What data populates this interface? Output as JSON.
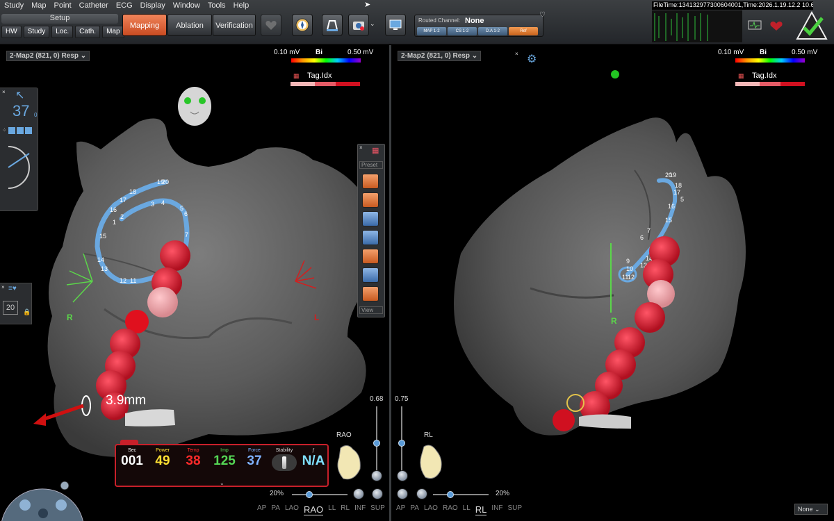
{
  "menu": [
    "Study",
    "Map",
    "Point",
    "Catheter",
    "ECG",
    "Display",
    "Window",
    "Tools",
    "Help"
  ],
  "setup": {
    "title": "Setup",
    "tabs": [
      "HW",
      "Study",
      "Loc.",
      "Cath.",
      "Map"
    ]
  },
  "modes": {
    "mapping": "Mapping",
    "ablation": "Ablation",
    "verification": "Verification"
  },
  "routed": {
    "label": "Routed Channel:",
    "value": "None",
    "chips": [
      "MAP 1-2",
      "CS 1-2",
      "D.A 1-2",
      "Ref"
    ]
  },
  "filetime": "FileTime:134132977300604001,Time:2026.1.19.12.2  10.60",
  "left_view": {
    "map_select": "2-Map2 (821, 0) Resp",
    "colorbar": {
      "min": "0.10 mV",
      "title": "Bi",
      "max": "0.50 mV"
    },
    "tag": {
      "title": "Tag.Idx"
    },
    "nav_value": "37",
    "nav_unit": "0",
    "zoom_value": "20",
    "orient_r": "R",
    "orient_l": "L",
    "distance": "3.9mm",
    "side_tools": {
      "preset": "Preset",
      "view": "View"
    },
    "electrode_labels": [
      "19",
      "20",
      "18",
      "17",
      "16",
      "15",
      "14",
      "13",
      "12",
      "11",
      "1",
      "2",
      "3",
      "4",
      "5",
      "6",
      "7"
    ],
    "slider_value": "0.68",
    "view_label": "RAO",
    "zoom_pct": "20%",
    "views": [
      "AP",
      "PA",
      "LAO",
      "RAO",
      "LL",
      "RL",
      "INF",
      "SUP"
    ],
    "active_view": "RAO"
  },
  "right_view": {
    "map_select": "2-Map2 (821, 0) Resp",
    "colorbar": {
      "min": "0.10 mV",
      "title": "Bi",
      "max": "0.50 mV"
    },
    "tag": {
      "title": "Tag.Idx"
    },
    "orient_r": "R",
    "electrode_labels": [
      "20",
      "19",
      "18",
      "17",
      "5",
      "16",
      "15",
      "7",
      "6",
      "14",
      "13",
      "10",
      "9",
      "12",
      "11"
    ],
    "slider_value": "0.75",
    "view_label": "RL",
    "zoom_pct": "20%",
    "views": [
      "AP",
      "PA",
      "LAO",
      "RAO",
      "LL",
      "RL",
      "INF",
      "SUP"
    ],
    "active_view": "RL",
    "dropdown": "None"
  },
  "ablation": {
    "columns": [
      {
        "label": "Sec",
        "value": "001",
        "color": "#ffffff"
      },
      {
        "label": "Power",
        "value": "49",
        "color": "#ffe033"
      },
      {
        "label": "Temp",
        "value": "38",
        "color": "#ff2a2a"
      },
      {
        "label": "Imp",
        "value": "125",
        "color": "#55d655"
      },
      {
        "label": "Force",
        "value": "37",
        "color": "#7fb2ff"
      },
      {
        "label": "Stability",
        "value": "",
        "color": "#dddddd"
      },
      {
        "label": "ƒ",
        "value": "N/A",
        "color": "#7fe0ff"
      }
    ]
  }
}
